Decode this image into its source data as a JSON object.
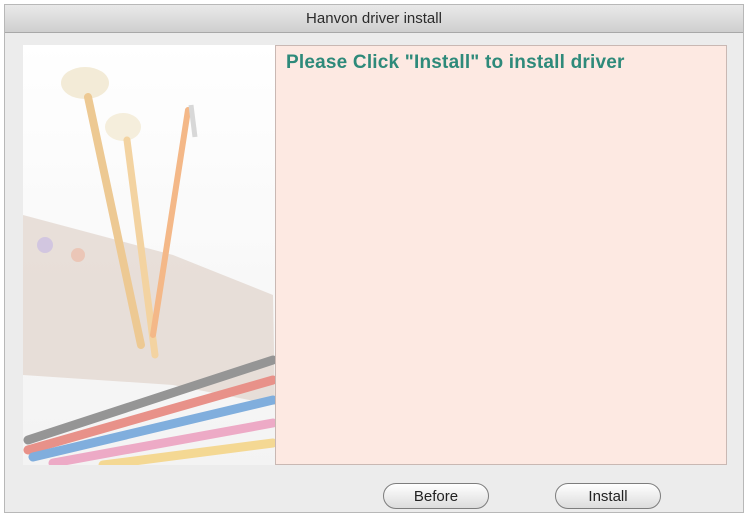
{
  "window": {
    "title": "Hanvon driver install"
  },
  "message": {
    "text": "Please Click \"Install\" to install driver"
  },
  "buttons": {
    "before_label": "Before",
    "install_label": "Install"
  },
  "colors": {
    "message_text": "#2e8a7a",
    "message_background": "#fde9e2",
    "window_background": "#ececec"
  },
  "icons": {
    "artwork": "paintbrushes-palette-pencils-illustration"
  }
}
